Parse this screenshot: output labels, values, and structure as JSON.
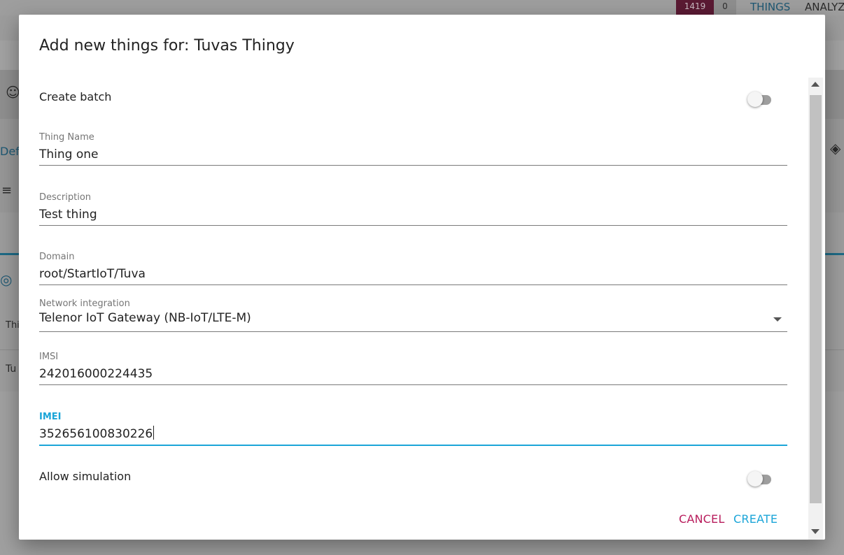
{
  "background": {
    "badge_count": "1419",
    "badge_zero": "0",
    "nav_things": "THINGS",
    "nav_analyze": "ANALYZ",
    "left_tab_fragment": "Defa",
    "left_row1_fragment": "Thi",
    "left_row2_fragment": "Tu"
  },
  "dialog": {
    "title": "Add new things for: Tuvas Thingy",
    "create_batch": {
      "label": "Create batch",
      "on": false
    },
    "fields": {
      "thing_name": {
        "label": "Thing Name",
        "value": "Thing one"
      },
      "description": {
        "label": "Description",
        "value": "Test thing"
      },
      "domain": {
        "label": "Domain",
        "value": "root/StartIoT/Tuva"
      },
      "network_integration": {
        "label": "Network integration",
        "value": "Telenor IoT Gateway (NB-IoT/LTE-M)"
      },
      "imsi": {
        "label": "IMSI",
        "value": "242016000224435"
      },
      "imei": {
        "label": "IMEI",
        "value": "352656100830226"
      }
    },
    "allow_simulation": {
      "label": "Allow simulation",
      "on": false
    },
    "buttons": {
      "cancel": "CANCEL",
      "create": "CREATE"
    }
  },
  "colors": {
    "accent_blue": "#1ba5d8",
    "cancel_magenta": "#b81c5c",
    "badge_red": "#5a1a33"
  }
}
